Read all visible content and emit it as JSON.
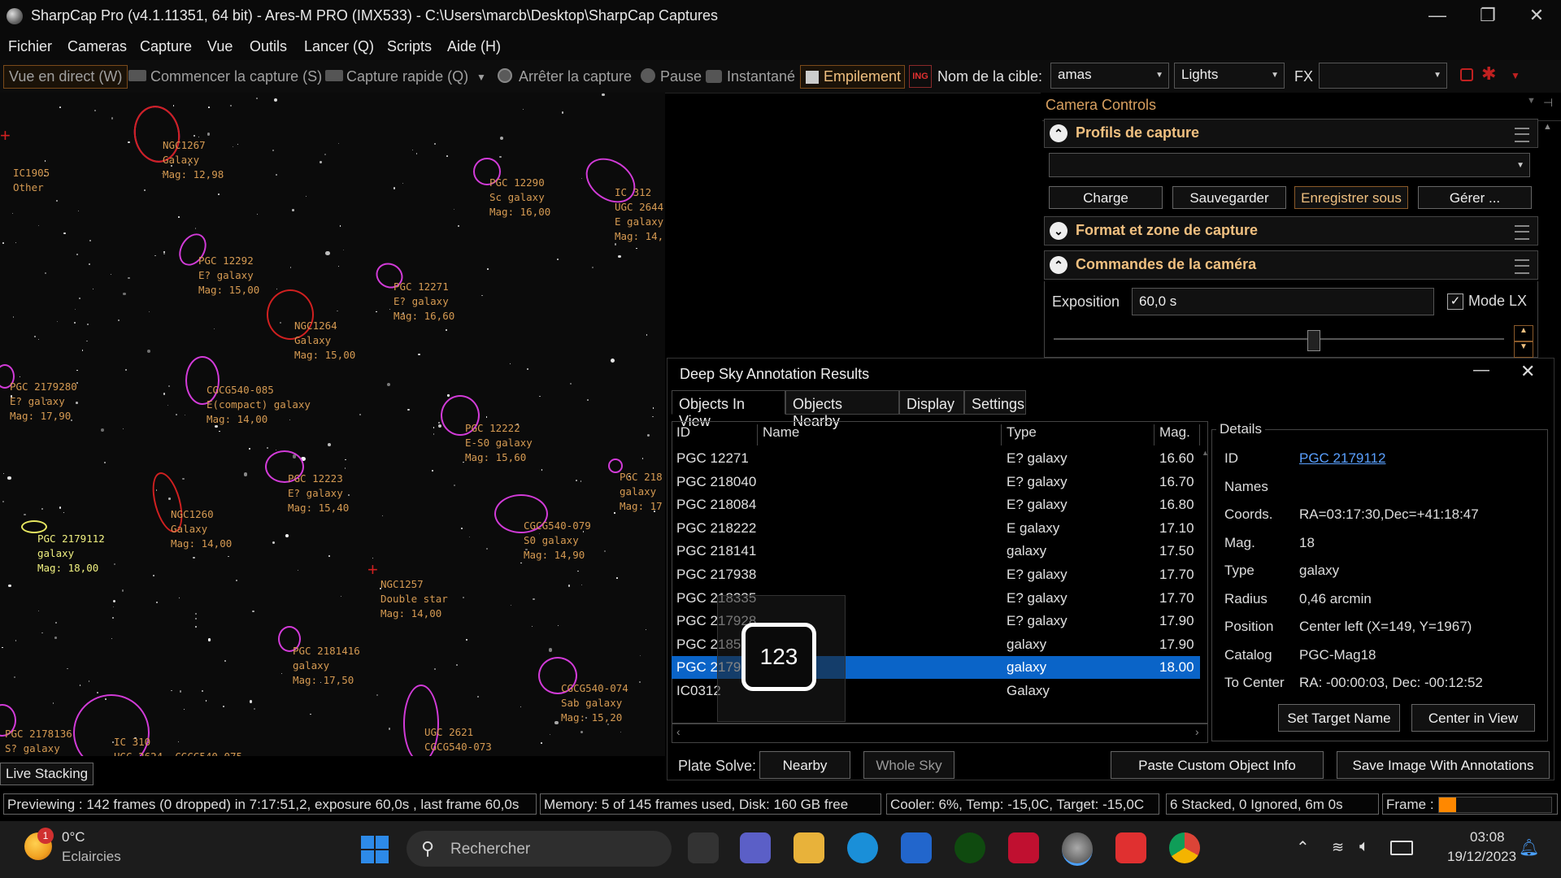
{
  "window": {
    "title": "SharpCap Pro (v4.1.11351, 64 bit) - Ares-M PRO (IMX533) - C:\\Users\\marcb\\Desktop\\SharpCap Captures",
    "controls": [
      "—",
      "❐",
      "✕"
    ]
  },
  "menu": [
    "Fichier",
    "Cameras",
    "Capture",
    "Vue",
    "Outils",
    "Lancer (Q)",
    "Scripts",
    "Aide (H)"
  ],
  "toolbar": {
    "live_view": "Vue en direct (W)",
    "start_capture": "Commencer la capture (S)",
    "quick_capture": "Capture rapide (Q)",
    "stop_capture": "Arrêter la capture",
    "pause": "Pause",
    "snapshot": "Instantané",
    "stacking": "Empilement",
    "target_label": "Nom de la cible:",
    "target_value": "amas",
    "frame_type": "Lights",
    "fx_label": "FX",
    "fx_value": ""
  },
  "annotations": [
    {
      "text": "NGC1267\nGalaxy\nMag: 12,98"
    },
    {
      "text": "IC1905\nOther"
    },
    {
      "text": "PGC 12290\nSc galaxy\nMag: 16,00"
    },
    {
      "text": "IC 312\nUGC 2644\nE galaxy\nMag: 14,"
    },
    {
      "text": "PGC 12292\nE? galaxy\nMag: 15,00"
    },
    {
      "text": "PGC 12271\nE? galaxy\nMag: 16,60"
    },
    {
      "text": "NGC1264\nGalaxy\nMag: 15,00"
    },
    {
      "text": "PGC 2179280\nE? galaxy\nMag: 17,90"
    },
    {
      "text": "CGCG540-085\nE(compact) galaxy\nMag: 14,00"
    },
    {
      "text": "PGC 12222\nE-S0 galaxy\nMag: 15,60"
    },
    {
      "text": "PGC 218\ngalaxy\nMag: 17"
    },
    {
      "text": "PGC 12223\nE? galaxy\nMag: 15,40"
    },
    {
      "text": "NGC1260\nGalaxy\nMag: 14,00"
    },
    {
      "text": "CGCG540-079\nS0 galaxy\nMag: 14,90"
    },
    {
      "text": "PGC 2179112\ngalaxy\nMag: 18,00"
    },
    {
      "text": "NGC1257\nDouble star\nMag: 14,00"
    },
    {
      "text": "PGC 2181416\ngalaxy\nMag: 17,50"
    },
    {
      "text": "CGCG540-074\nSab galaxy\nMag: 15,20"
    },
    {
      "text": "PGC 2178136\nS? galaxy"
    },
    {
      "text": "IC 310\nUGC 2624  CGCG540-075"
    },
    {
      "text": "UGC 2621\nCGCG540-073"
    }
  ],
  "live_stacking_tab": "Live Stacking",
  "camera_controls": {
    "header": "Camera Controls",
    "profiles_title": "Profils de capture",
    "profile_value": "",
    "buttons": [
      "Charge",
      "Sauvegarder",
      "Enregistrer sous",
      "Gérer ..."
    ],
    "format_title": "Format et zone de capture",
    "commands_title": "Commandes de la caméra",
    "exposure_label": "Exposition",
    "exposure_value": "60,0 s",
    "lx_label": "Mode LX",
    "lx_checked": true
  },
  "dialog": {
    "title": "Deep Sky Annotation Results",
    "tabs": [
      "Objects In View",
      "Objects Nearby",
      "Display",
      "Settings"
    ],
    "columns": [
      "ID",
      "Name",
      "Type",
      "Mag."
    ],
    "rows": [
      {
        "id": "PGC 12271",
        "name": "",
        "type": "E? galaxy",
        "mag": "16.60"
      },
      {
        "id": "PGC 218040",
        "name": "",
        "type": "E? galaxy",
        "mag": "16.70"
      },
      {
        "id": "PGC 218084",
        "name": "",
        "type": "E? galaxy",
        "mag": "16.80"
      },
      {
        "id": "PGC 218222",
        "name": "",
        "type": "E galaxy",
        "mag": "17.10"
      },
      {
        "id": "PGC 218141",
        "name": "",
        "type": "galaxy",
        "mag": "17.50"
      },
      {
        "id": "PGC 217938",
        "name": "",
        "type": "E? galaxy",
        "mag": "17.70"
      },
      {
        "id": "PGC 218335",
        "name": "",
        "type": "E? galaxy",
        "mag": "17.70"
      },
      {
        "id": "PGC 217928",
        "name": "",
        "type": "E? galaxy",
        "mag": "17.90"
      },
      {
        "id": "PGC 2185",
        "name": "",
        "type": "galaxy",
        "mag": "17.90"
      },
      {
        "id": "PGC 2179 1",
        "name": "",
        "type": "galaxy",
        "mag": "18.00",
        "selected": true
      },
      {
        "id": "IC0312",
        "name": "",
        "type": "Galaxy",
        "mag": ""
      }
    ],
    "details_title": "Details",
    "details": [
      {
        "label": "ID",
        "value": "PGC 2179112"
      },
      {
        "label": "Names",
        "value": ""
      },
      {
        "label": "Coords.",
        "value": "RA=03:17:30,Dec=+41:18:47"
      },
      {
        "label": "Mag.",
        "value": "18"
      },
      {
        "label": "Type",
        "value": "galaxy"
      },
      {
        "label": "Radius",
        "value": "0,46 arcmin"
      },
      {
        "label": "Position",
        "value": "Center left (X=149, Y=1967)"
      },
      {
        "label": "Catalog",
        "value": "PGC-Mag18"
      },
      {
        "label": "To Center",
        "value": "RA: -00:00:03, Dec: -00:12:52"
      }
    ],
    "set_target": "Set Target Name",
    "center_view": "Center in View",
    "plate_solve_label": "Plate Solve:",
    "nearby_btn": "Nearby",
    "whole_sky_btn": "Whole Sky",
    "paste_btn": "Paste Custom Object Info",
    "save_btn": "Save Image With Annotations",
    "overlay_badge": "123"
  },
  "status": {
    "preview": "Previewing : 142 frames (0 dropped) in 7:17:51,2, exposure 60,0s , last frame 60,0s",
    "memory": "Memory: 5 of 145 frames used, Disk: 160 GB free",
    "cooler": "Cooler: 6%, Temp: -15,0C, Target: -15,0C",
    "stacked": "6 Stacked, 0 Ignored, 6m 0s",
    "frame_label": "Frame :",
    "frame_progress": 0.15
  },
  "taskbar": {
    "weather_temp": "0°C",
    "weather_desc": "Eclaircies",
    "weather_badge": "1",
    "search_placeholder": "Rechercher",
    "time": "03:08",
    "date": "19/12/2023"
  },
  "colors": {
    "accent_orange": "#f0c080",
    "annotation": "#d59a52",
    "ellipse": "#d23bd8",
    "selection": "#0a64c8"
  }
}
